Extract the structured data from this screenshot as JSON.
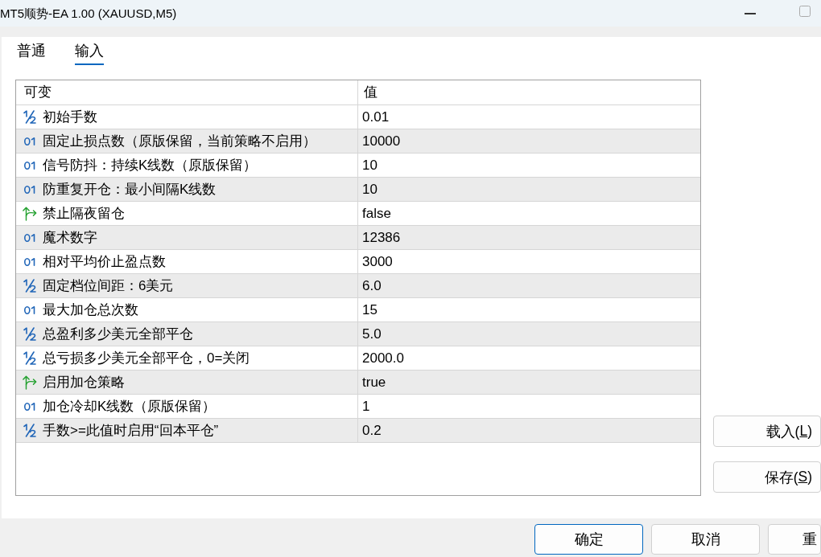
{
  "window": {
    "title": "MT5顺势-EA 1.00 (XAUUSD,M5)"
  },
  "tabs": [
    {
      "label": "普通",
      "selected": false
    },
    {
      "label": "输入",
      "selected": true
    }
  ],
  "table": {
    "columns": [
      "可变",
      "值"
    ],
    "rows": [
      {
        "kind": "double",
        "name": "初始手数",
        "value": "0.01"
      },
      {
        "kind": "int",
        "name": "固定止损点数（原版保留，当前策略不启用）",
        "value": "10000"
      },
      {
        "kind": "int",
        "name": "信号防抖：持续K线数（原版保留）",
        "value": "10"
      },
      {
        "kind": "int",
        "name": "防重复开仓：最小间隔K线数",
        "value": "10"
      },
      {
        "kind": "bool",
        "name": "禁止隔夜留仓",
        "value": "false"
      },
      {
        "kind": "int",
        "name": "魔术数字",
        "value": "12386"
      },
      {
        "kind": "int",
        "name": "相对平均价止盈点数",
        "value": "3000"
      },
      {
        "kind": "double",
        "name": "固定档位间距：6美元",
        "value": "6.0"
      },
      {
        "kind": "int",
        "name": "最大加仓总次数",
        "value": "15"
      },
      {
        "kind": "double",
        "name": "总盈利多少美元全部平仓",
        "value": "5.0"
      },
      {
        "kind": "double",
        "name": "总亏损多少美元全部平仓，0=关闭",
        "value": "2000.0"
      },
      {
        "kind": "bool",
        "name": "启用加仓策略",
        "value": "true"
      },
      {
        "kind": "int",
        "name": "加仓冷却K线数（原版保留）",
        "value": "1"
      },
      {
        "kind": "double",
        "name": "手数>=此值时启用“回本平仓”",
        "value": "0.2"
      }
    ]
  },
  "side_buttons": [
    {
      "text": "载入(",
      "mnemonic": "L",
      "text_after": ")"
    },
    {
      "text": "保存(",
      "mnemonic": "S",
      "text_after": ")"
    }
  ],
  "buttons": [
    {
      "label": "确定",
      "default": true
    },
    {
      "label": "取消",
      "default": false
    },
    {
      "label": "重",
      "default": false
    }
  ]
}
